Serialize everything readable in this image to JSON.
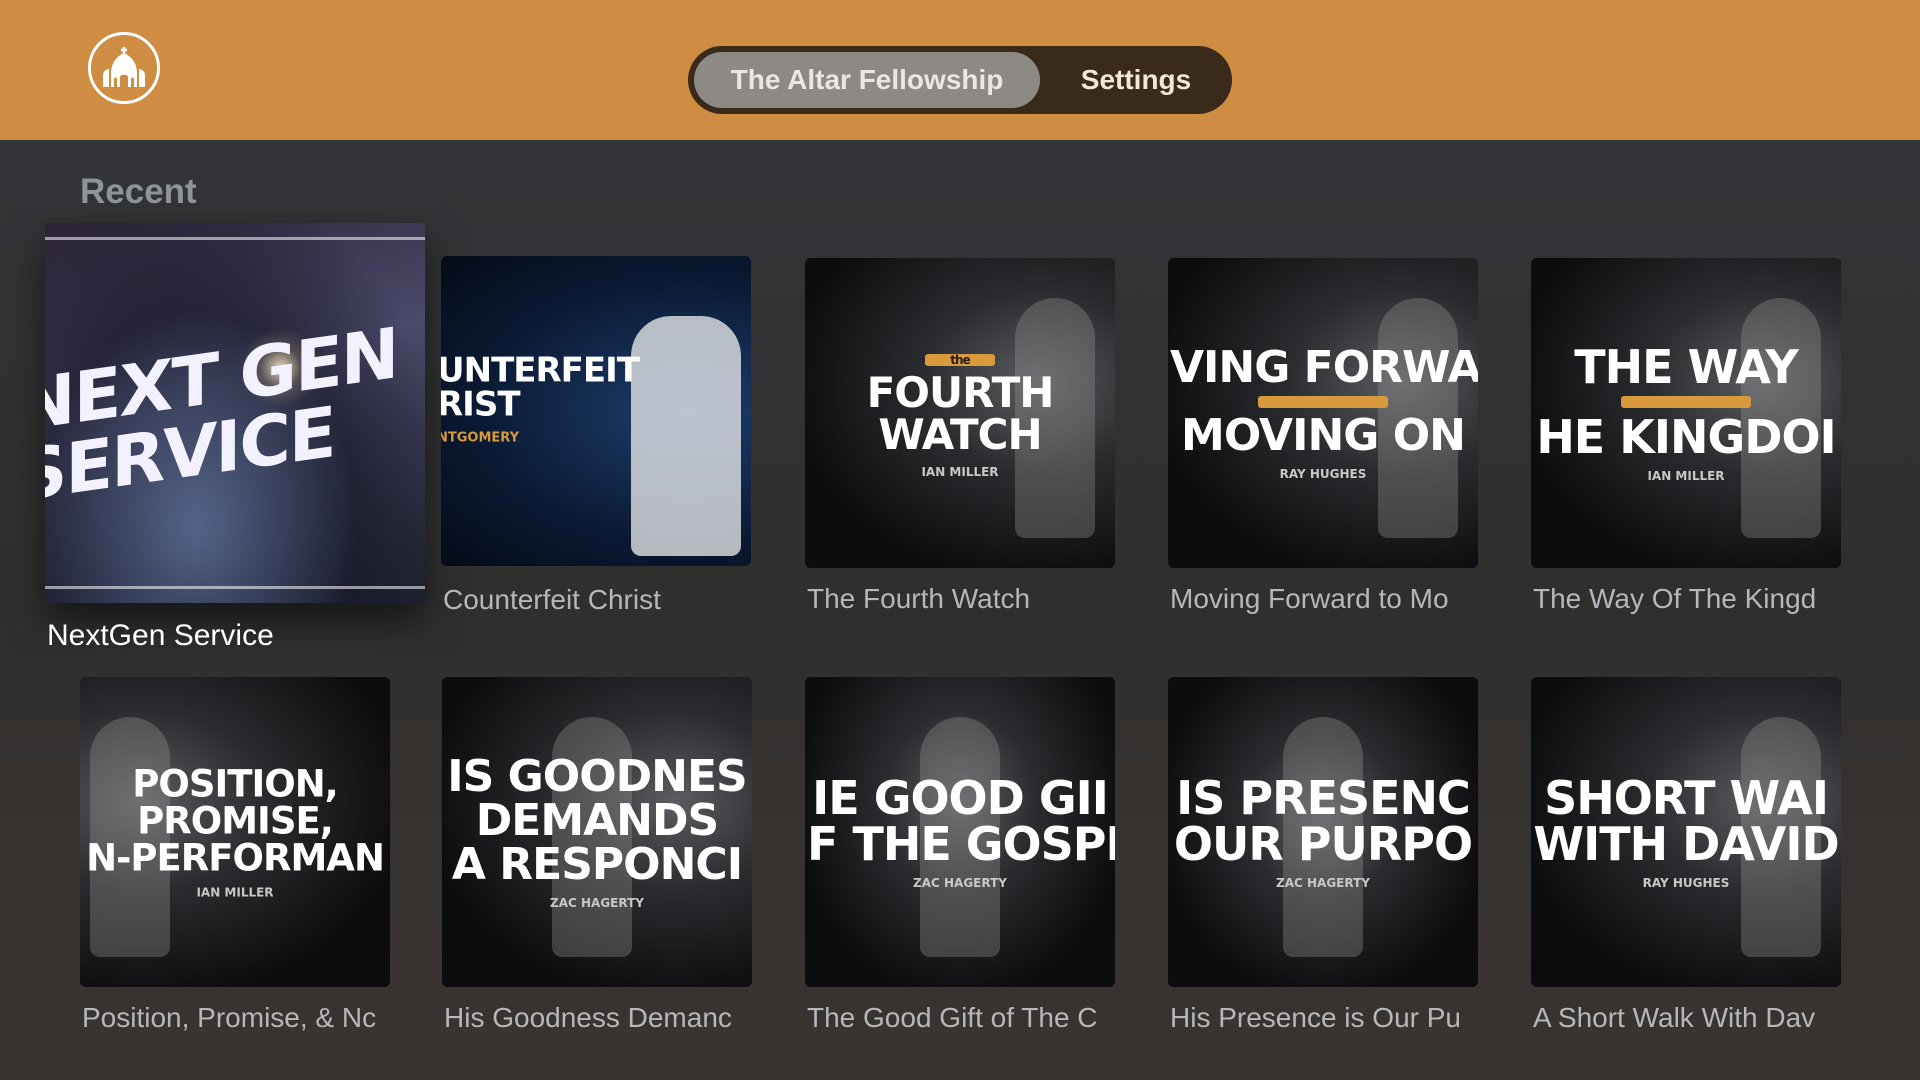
{
  "app": {
    "brand_icon": "church-icon",
    "colors": {
      "topbar": "#cf8d43",
      "accent": "#d99a3e"
    }
  },
  "nav": {
    "tabs": [
      {
        "label": "The Altar Fellowship",
        "selected": true
      },
      {
        "label": "Settings",
        "selected": false
      }
    ]
  },
  "section": {
    "title": "Recent"
  },
  "items": [
    {
      "title": "NextGen Service",
      "art_lines": [
        "NEXT GEN",
        "SERVICE"
      ],
      "speaker": "",
      "focused": true
    },
    {
      "title": "Counterfeit Christ",
      "art_lines": [
        "UNTERFEIT",
        "RIST"
      ],
      "speaker": "NTGOMERY"
    },
    {
      "title": "The Fourth Watch",
      "art_lines": [
        "FOURTH",
        "WATCH"
      ],
      "art_kicker": "the",
      "speaker": "IAN MILLER"
    },
    {
      "title": "Moving Forward to Mo",
      "art_lines": [
        "VING FORWA",
        "MOVING ON"
      ],
      "speaker": "RAY HUGHES"
    },
    {
      "title": "The Way Of The Kingd",
      "art_lines": [
        "THE WAY",
        "HE KINGDOI"
      ],
      "speaker": "IAN MILLER"
    },
    {
      "title": "Position, Promise, & Nc",
      "art_lines": [
        "POSITION,",
        "PROMISE,",
        "N-PERFORMAN"
      ],
      "speaker": "IAN MILLER"
    },
    {
      "title": "His Goodness Demanc",
      "art_lines": [
        "IS GOODNES",
        "DEMANDS",
        "A RESPONCI"
      ],
      "speaker": "ZAC HAGERTY"
    },
    {
      "title": "The Good Gift of The C",
      "art_lines": [
        "IE GOOD GII",
        "F THE GOSPI"
      ],
      "speaker": "ZAC HAGERTY"
    },
    {
      "title": "His Presence is Our Pu",
      "art_lines": [
        "IS PRESENC",
        "OUR PURPO"
      ],
      "speaker": "ZAC HAGERTY"
    },
    {
      "title": "A Short Walk With Dav",
      "art_lines": [
        "SHORT WAI",
        "WITH DAVID"
      ],
      "speaker": "RAY HUGHES"
    }
  ]
}
